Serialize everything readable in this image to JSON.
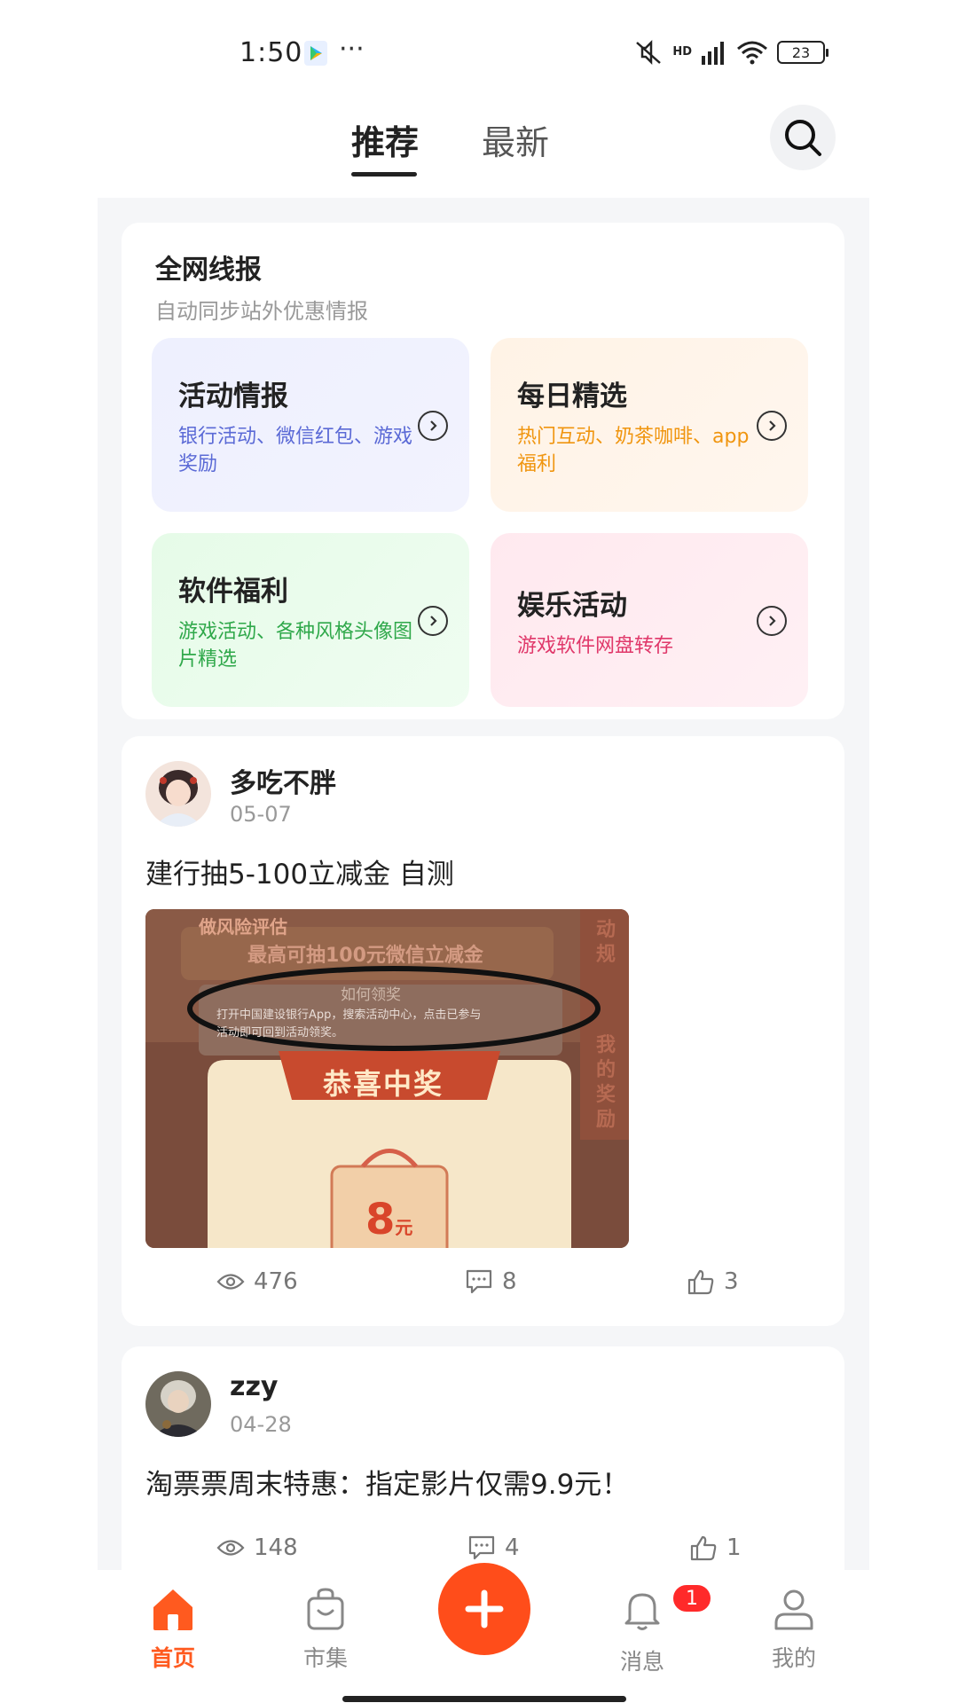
{
  "status_bar": {
    "time": "1:50",
    "dots": "···",
    "network": "HD",
    "battery": "23",
    "icons": [
      "mute-icon",
      "signal-icon",
      "wifi-icon",
      "battery-icon"
    ]
  },
  "top_tabs": {
    "tabs": [
      {
        "label": "推荐",
        "active": true
      },
      {
        "label": "最新",
        "active": false
      }
    ],
    "search_icon": "search-icon"
  },
  "info_section": {
    "title": "全网线报",
    "subtitle": "自动同步站外优惠情报",
    "categories": [
      {
        "name": "活动情报",
        "desc": "银行活动、微信红包、游戏奖励",
        "color": "#5b6ad6"
      },
      {
        "name": "每日精选",
        "desc": "热门互动、奶茶咖啡、app福利",
        "color": "#f0950f"
      },
      {
        "name": "软件福利",
        "desc": "游戏活动、各种风格头像图片精选",
        "color": "#2fa84a"
      },
      {
        "name": "娱乐活动",
        "desc": "游戏软件网盘转存",
        "color": "#e0386a"
      }
    ]
  },
  "posts": [
    {
      "username": "多吃不胖",
      "date": "05-07",
      "title": "建行抽5-100立减金 自测",
      "image": {
        "top_label": "做风险评估",
        "headline": "最高可抽100元微信立减金",
        "how_label": "如何领奖",
        "instruction_1": "打开中国建设银行App，搜索活动中心，点击已参与",
        "instruction_2": "活动即可回到活动领奖。",
        "prize_title": "恭喜中奖",
        "prize_amount": "8",
        "prize_unit": "元",
        "side_1": "动规",
        "side_2": "我的奖励"
      },
      "views": "476",
      "comments": "8",
      "likes": "3"
    },
    {
      "username": "zzy",
      "date": "04-28",
      "title": "淘票票周末特惠：指定影片仅需9.9元！",
      "views": "148",
      "comments": "4",
      "likes": "1"
    }
  ],
  "bottom_nav": {
    "items": [
      {
        "label": "首页",
        "icon": "home-icon",
        "active": true
      },
      {
        "label": "市集",
        "icon": "bag-icon",
        "active": false
      },
      {
        "label": "消息",
        "icon": "bell-icon",
        "active": false,
        "badge": "1"
      },
      {
        "label": "我的",
        "icon": "user-icon",
        "active": false
      }
    ],
    "post_icon": "plus-icon"
  },
  "colors": {
    "accent": "#ff4d1a",
    "active_tab_text": "#ff5a1f"
  }
}
